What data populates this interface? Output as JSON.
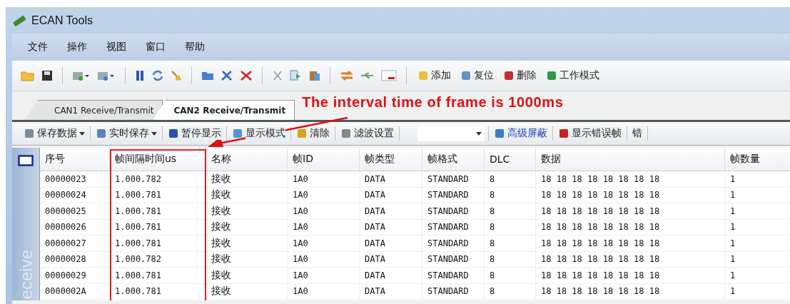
{
  "window": {
    "title": "ECAN Tools"
  },
  "menu": [
    "文件",
    "操作",
    "视图",
    "窗口",
    "帮助"
  ],
  "toolbar": [
    {
      "label": "添加"
    },
    {
      "label": "复位"
    },
    {
      "label": "删除"
    },
    {
      "label": "工作模式"
    }
  ],
  "tabs": [
    {
      "label": "CAN1 Receive/Transmit",
      "selected": false
    },
    {
      "label": "CAN2 Receive/Transmit",
      "selected": true
    }
  ],
  "annotation": "The interval time of frame is 1000ms",
  "subtoolbar": [
    {
      "kind": "button",
      "label": "保存数据",
      "dropdown": true
    },
    {
      "kind": "button",
      "label": "实时保存",
      "dropdown": true
    },
    {
      "kind": "button",
      "label": "暂停显示",
      "dropdown": false
    },
    {
      "kind": "button",
      "label": "显示模式",
      "dropdown": false
    },
    {
      "kind": "button",
      "label": "清除",
      "dropdown": false
    },
    {
      "kind": "button",
      "label": "滤波设置",
      "dropdown": false
    },
    {
      "kind": "combo"
    },
    {
      "kind": "link",
      "label": "高级屏蔽",
      "dropdown": false
    },
    {
      "kind": "button",
      "label": "显示错误帧",
      "dropdown": false
    },
    {
      "kind": "button",
      "label": "错",
      "dropdown": false
    }
  ],
  "side_panel": {
    "label": "eceive"
  },
  "table": {
    "columns": [
      "序号",
      "帧间隔时间us",
      "名称",
      "帧ID",
      "帧类型",
      "帧格式",
      "DLC",
      "数据",
      "帧数量"
    ],
    "rows": [
      [
        "00000023",
        "1.000.782",
        "接收",
        "1A0",
        "DATA",
        "STANDARD",
        "8",
        "18 18 18 18 18 18 18 18",
        "1"
      ],
      [
        "00000024",
        "1.000.781",
        "接收",
        "1A0",
        "DATA",
        "STANDARD",
        "8",
        "18 18 18 18 18 18 18 18",
        "1"
      ],
      [
        "00000025",
        "1.000.781",
        "接收",
        "1A0",
        "DATA",
        "STANDARD",
        "8",
        "18 18 18 18 18 18 18 18",
        "1"
      ],
      [
        "00000026",
        "1.000.781",
        "接收",
        "1A0",
        "DATA",
        "STANDARD",
        "8",
        "18 18 18 18 18 18 18 18",
        "1"
      ],
      [
        "00000027",
        "1.000.781",
        "接收",
        "1A0",
        "DATA",
        "STANDARD",
        "8",
        "18 18 18 18 18 18 18 18",
        "1"
      ],
      [
        "00000028",
        "1.000.782",
        "接收",
        "1A0",
        "DATA",
        "STANDARD",
        "8",
        "18 18 18 18 18 18 18 18",
        "1"
      ],
      [
        "00000029",
        "1.000.781",
        "接收",
        "1A0",
        "DATA",
        "STANDARD",
        "8",
        "18 18 18 18 18 18 18 18",
        "1"
      ],
      [
        "0000002A",
        "1.000.781",
        "接收",
        "1A0",
        "DATA",
        "STANDARD",
        "8",
        "18 18 18 18 18 18 18 18",
        "1"
      ]
    ]
  }
}
